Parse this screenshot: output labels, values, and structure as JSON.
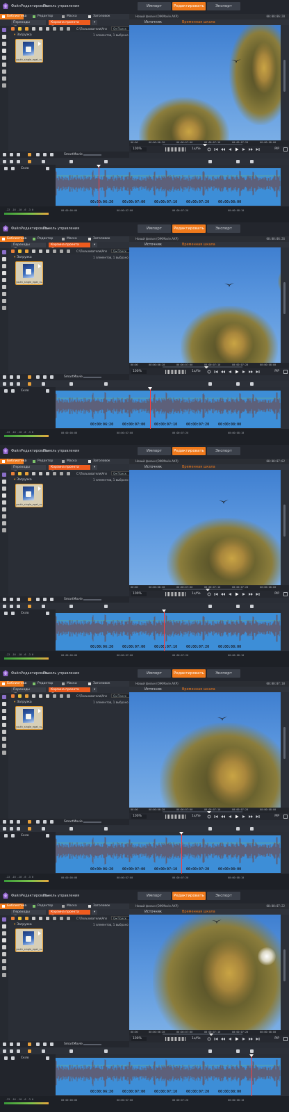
{
  "menu": {
    "items": [
      "Файл",
      "Редактировать",
      "Панель управления"
    ]
  },
  "mode_tabs": [
    "Импорт",
    "Редактировать",
    "Экспорт"
  ],
  "mode_active": "Редактировать",
  "library": {
    "tabs": [
      "Библиотека",
      "Редактор",
      "Маска",
      "Заголовок"
    ],
    "active_tab": "Библиотека",
    "breadcrumbs": [
      "Переходы (Популярн...",
      "Корзина проекта (Без..."
    ],
    "path": "C:\\Пользователи\\Ann",
    "search_placeholder": "Q▾ Поиск",
    "load_label": "Загрузка",
    "status": "1 элементов, 1 выбрано",
    "clip_label": "youth_single_egat_ru..."
  },
  "preview": {
    "file_title": "Новый фильм (ОЖМovie.AXP)",
    "tabs": [
      "Источник",
      "Временная шкала"
    ],
    "active_tab": "Временная шкала",
    "zoom": "100%",
    "speed": "1x/fie",
    "pip": "PIP",
    "ruler_ticks": [
      "00:00",
      "00:00:06:20",
      "00:00:07:00",
      "00:00:07:10",
      "00:00:07:20",
      "00:00:08:00"
    ]
  },
  "smart_movie": "SmartMovie",
  "timeline": {
    "track_name": "Скло",
    "time_labels": [
      "00:00:06:20",
      "00:00:07:00",
      "00:00:07:10",
      "00:00:07:20",
      "00:00:08:00"
    ],
    "meter_numbers": "-22 -16 -10 -6 -3 0",
    "bottom_times": [
      "00:00:00:00",
      "00:00:07:00",
      "00:00:07:20",
      "00:00:08:10",
      "00:00:08:00"
    ]
  },
  "frames": [
    {
      "timecode": "00:00:06:20",
      "playhead_fraction": 0.19
    },
    {
      "timecode": "00:00:06:26",
      "playhead_fraction": 0.42
    },
    {
      "timecode": "00:00:07:02",
      "playhead_fraction": 0.48
    },
    {
      "timecode": "00:00:07:10",
      "playhead_fraction": 0.56
    },
    {
      "timecode": "00:00:07:22",
      "playhead_fraction": 0.87
    }
  ],
  "colors": {
    "accent": "#f07a1c",
    "breadcrumb_active": "#ee5b1e",
    "audio_bg": "#3d8ed7",
    "waveform": "#7a3a2a",
    "playhead": "#ff3b3b"
  }
}
